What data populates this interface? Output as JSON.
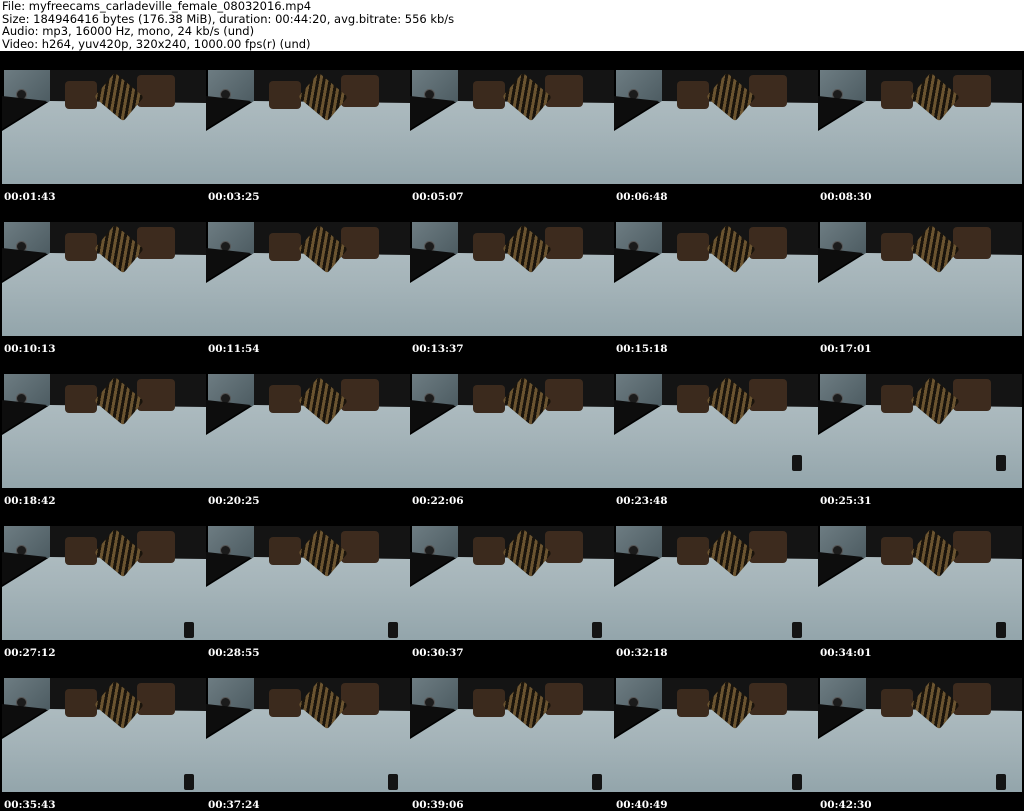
{
  "header": {
    "file": "File: myfreecams_carladeville_female_08032016.mp4",
    "size": "Size: 184946416 bytes (176.38 MiB), duration: 00:44:20, avg.bitrate: 556 kb/s",
    "audio": "Audio: mp3, 16000 Hz, mono, 24 kb/s (und)",
    "video": "Video: h264, yuv420p, 320x240, 1000.00 fps(r) (und)"
  },
  "thumbnails": [
    "00:01:43",
    "00:03:25",
    "00:05:07",
    "00:06:48",
    "00:08:30",
    "00:10:13",
    "00:11:54",
    "00:13:37",
    "00:15:18",
    "00:17:01",
    "00:18:42",
    "00:20:25",
    "00:22:06",
    "00:23:48",
    "00:25:31",
    "00:27:12",
    "00:28:55",
    "00:30:37",
    "00:32:18",
    "00:34:01",
    "00:35:43",
    "00:37:24",
    "00:39:06",
    "00:40:49",
    "00:42:30"
  ]
}
